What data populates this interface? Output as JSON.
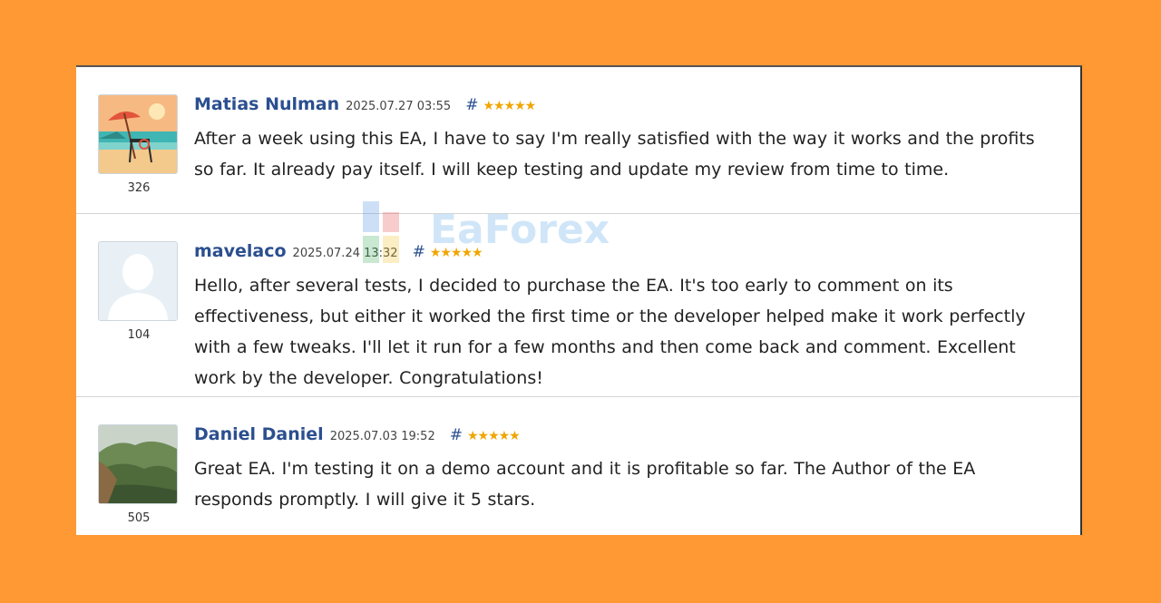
{
  "reviews": [
    {
      "author": "Matias Nulman",
      "date": "2025.07.27 03:55",
      "hash": "#",
      "stars": "★★★★★",
      "rating": 5,
      "count": "326",
      "avatar_icon": "beach-avatar-icon",
      "text": "After a week using this EA, I have to say I'm really satisfied with the way it works and the profits so far. It already pay itself. I will keep testing and update my review from time to time."
    },
    {
      "author": "mavelaco",
      "date": "2025.07.24 13:32",
      "hash": "#",
      "stars": "★★★★★",
      "rating": 5,
      "count": "104",
      "avatar_icon": "default-user-avatar-icon",
      "text": "Hello, after several tests, I decided to purchase the EA. It's too early to comment on its effectiveness, but either it worked the first time or the developer helped make it work perfectly with a few tweaks. I'll let it run for a few months and then come back and comment. Excellent work by the developer. Congratulations!"
    },
    {
      "author": "Daniel Daniel",
      "date": "2025.07.03 19:52",
      "hash": "#",
      "stars": "★★★★★",
      "rating": 5,
      "count": "505",
      "avatar_icon": "mountain-avatar-icon",
      "text": "Great EA. I'm testing it on a demo account and it is profitable so far. The Author of the EA responds promptly. I will give it 5 stars."
    }
  ],
  "watermark": "EaForex",
  "colors": {
    "background": "#ff9933",
    "author": "#2b4f8f",
    "stars": "#f0a500"
  }
}
